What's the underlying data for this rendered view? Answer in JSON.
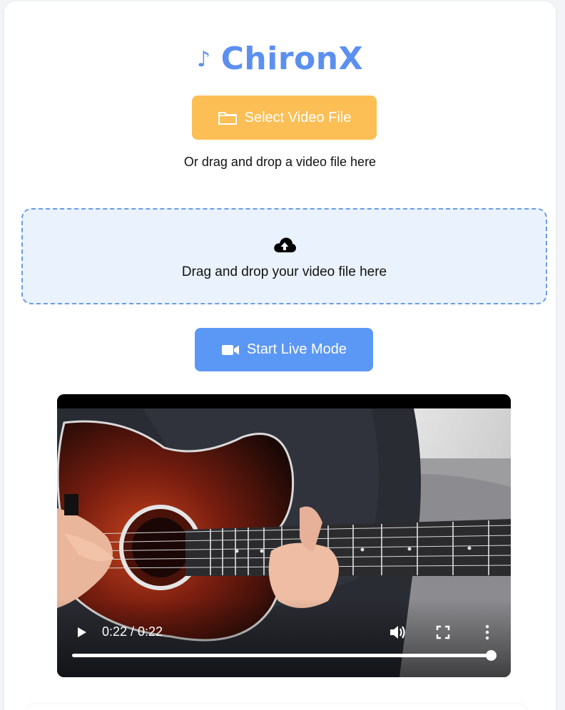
{
  "header": {
    "note_glyph": "♪",
    "title": "ChironX"
  },
  "upload": {
    "select_label": "Select Video File",
    "or_text": "Or drag and drop a video file here",
    "dropzone_text": "Drag and drop your video file here"
  },
  "live": {
    "label": "Start Live Mode"
  },
  "player": {
    "time": "0:22 / 0:22",
    "progress": 1.0
  },
  "icons": {
    "folder": "folder-icon",
    "cloud": "cloud-upload-icon",
    "camera": "video-camera-icon",
    "play": "play-icon",
    "volume": "volume-icon",
    "fullscreen": "fullscreen-icon",
    "more": "more-vert-icon"
  },
  "colors": {
    "accent_blue": "#5b8ff0",
    "select_button": "#fbbf55",
    "live_button": "#5b97f4",
    "dropzone_bg": "#eaf2fd",
    "dropzone_border": "#6b9ce8"
  }
}
